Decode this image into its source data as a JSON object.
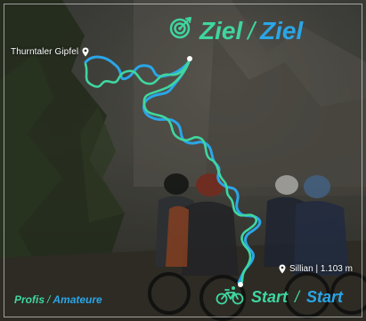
{
  "map": {
    "title_left": "Ziel",
    "title_separator": "/",
    "title_right": "Ziel",
    "start_left": "Start",
    "start_separator": "/",
    "start_right": "Start",
    "summit_label": "Thurntaler Gipfel",
    "start_label": "Sillian | 1.103 m",
    "legend_left": "Profis",
    "legend_separator": "/",
    "legend_right": "Amateure"
  },
  "colors": {
    "pro_route": "#3fd6a0",
    "amateur_route": "#2aa6e8",
    "text": "#ffffff"
  },
  "icons": {
    "goal": "target-icon",
    "start": "bicycle-icon",
    "location": "map-pin-icon"
  }
}
